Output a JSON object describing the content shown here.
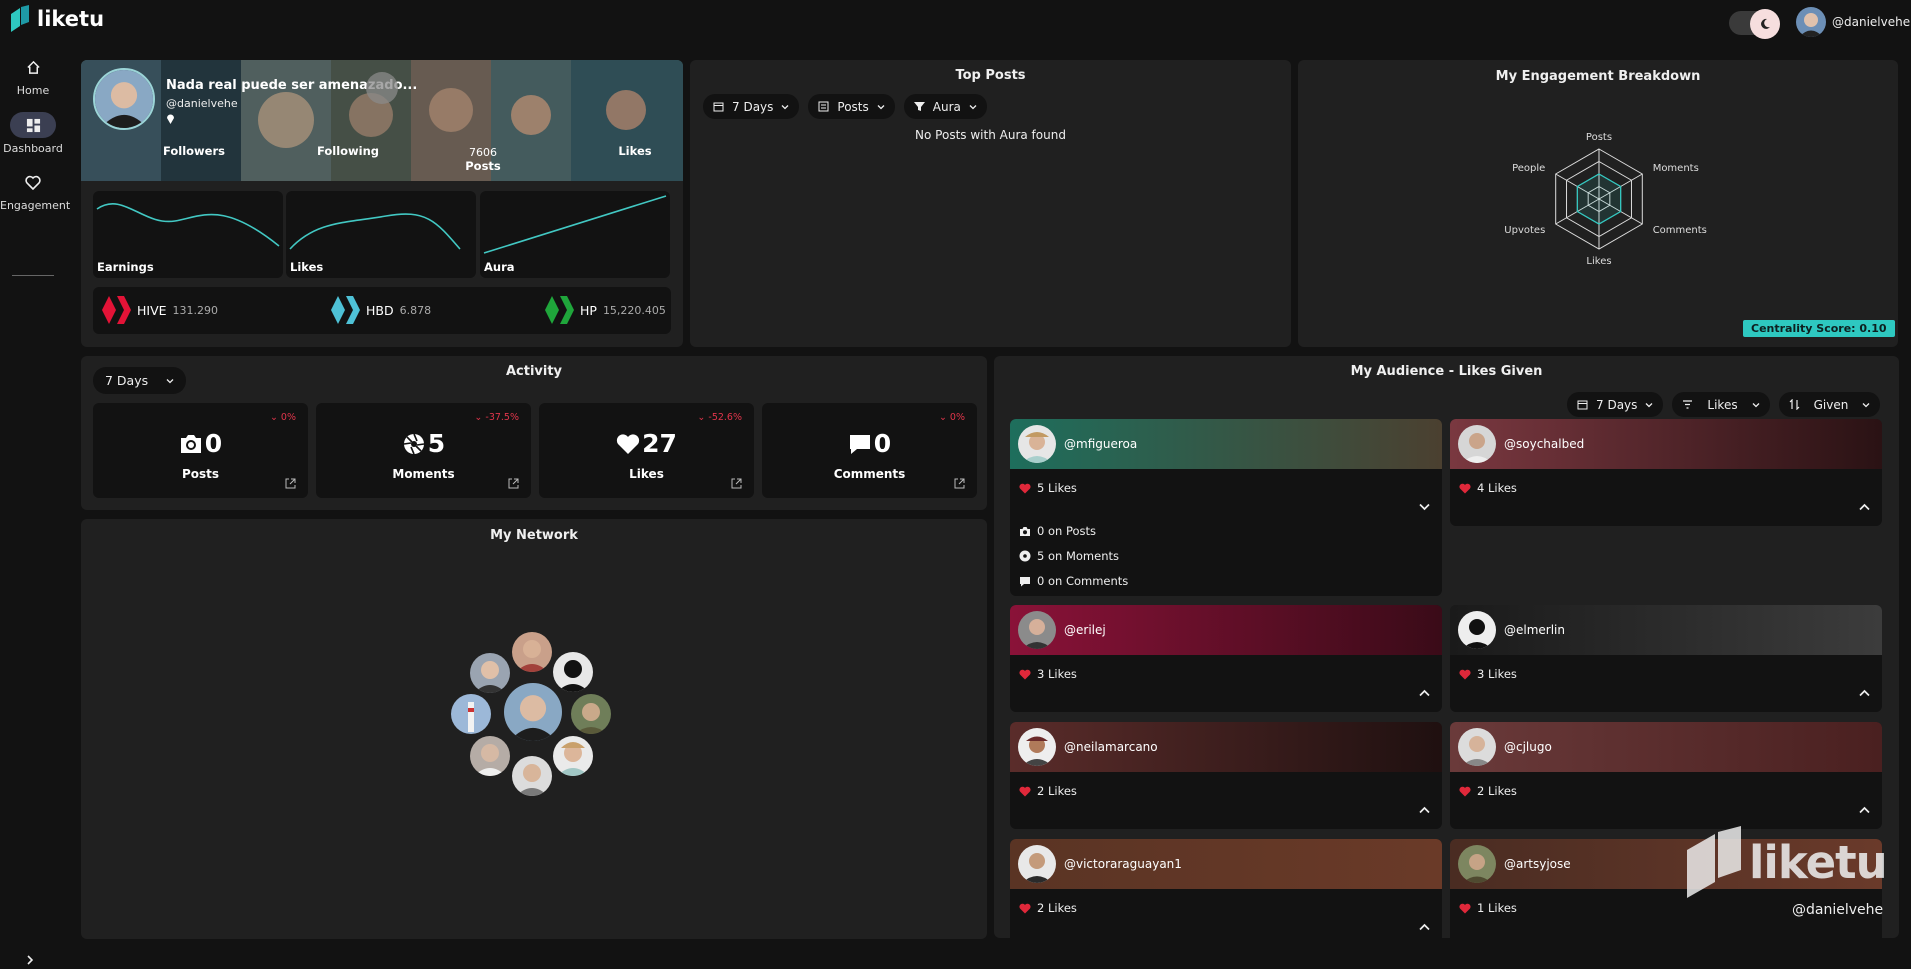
{
  "app": {
    "name": "liketu",
    "username": "@danielvehe"
  },
  "nav": {
    "home": "Home",
    "dashboard": "Dashboard",
    "engagement": "Engagement"
  },
  "profile": {
    "title": "Nada real puede ser amenazado...",
    "handle": "@danielvehe",
    "followers": "Followers",
    "following": "Following",
    "posts_value": "7606",
    "posts": "Posts",
    "likes": "Likes"
  },
  "sparks": {
    "earnings": "Earnings",
    "likes": "Likes",
    "aura": "Aura"
  },
  "wallet": {
    "hive": "HIVE",
    "hive_v": "131.290",
    "hbd": "HBD",
    "hbd_v": "6.878",
    "hp": "HP",
    "hp_v": "15,220.405"
  },
  "top_posts": {
    "title": "Top Posts",
    "f_days": "7 Days",
    "f_type": "Posts",
    "f_filter": "Aura",
    "empty": "No Posts with Aura found"
  },
  "engagement": {
    "title": "My Engagement Breakdown",
    "axes": [
      "Posts",
      "Moments",
      "Comments",
      "Likes",
      "Upvotes",
      "People"
    ],
    "score": "Centrality Score: 0.10"
  },
  "chart_data": {
    "type": "radar",
    "title": "My Engagement Breakdown",
    "axes": [
      "Posts",
      "Moments",
      "Comments",
      "Likes",
      "Upvotes",
      "People"
    ],
    "values": [
      0.1,
      0.1,
      0.1,
      0.1,
      0.1,
      0.1
    ]
  },
  "activity": {
    "title": "Activity",
    "days": "7 Days",
    "cards": [
      {
        "label": "Posts",
        "value": "0",
        "change": "0%"
      },
      {
        "label": "Moments",
        "value": "5",
        "change": "-37.5%"
      },
      {
        "label": "Likes",
        "value": "27",
        "change": "-52.6%"
      },
      {
        "label": "Comments",
        "value": "0",
        "change": "0%"
      }
    ]
  },
  "network": {
    "title": "My Network"
  },
  "audience": {
    "title": "My Audience - Likes Given",
    "f_days": "7 Days",
    "f_metric": "Likes",
    "f_dir": "Given",
    "users": [
      {
        "name": "@mfigueroa",
        "likes": "5 Likes",
        "posts": "0 on Posts",
        "moments": "5 on Moments",
        "comments": "0 on Comments"
      },
      {
        "name": "@soychalbed",
        "likes": "4 Likes"
      },
      {
        "name": "@erilej",
        "likes": "3 Likes"
      },
      {
        "name": "@elmerlin",
        "likes": "3 Likes"
      },
      {
        "name": "@neilamarcano",
        "likes": "2 Likes"
      },
      {
        "name": "@cjlugo",
        "likes": "2 Likes"
      },
      {
        "name": "@victoraraguayan1",
        "likes": "2 Likes"
      },
      {
        "name": "@artsyjose",
        "likes": "1 Likes"
      }
    ]
  },
  "watermark": {
    "brand": "liketu",
    "user": "@danielvehe"
  }
}
